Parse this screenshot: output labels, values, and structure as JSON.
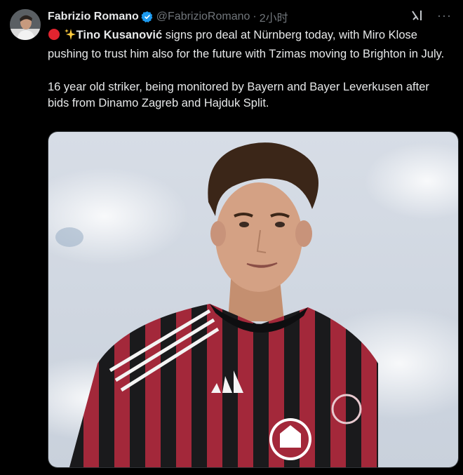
{
  "author": {
    "name": "Fabrizio Romano",
    "handle": "@FabrizioRomano",
    "separator": "·",
    "time": "2小时"
  },
  "tweet": {
    "headline_name": "Tino Kusanović",
    "paragraph1_rest": " signs pro deal at Nürnberg today, with Miro Klose pushing to trust him also for the future with Tzimas moving to Brighton in July.",
    "paragraph2": "16 year old striker, being monitored by Bayern and Bayer Leverkusen after bids from Dinamo Zagreb and Hajduk Split."
  },
  "icons": {
    "verified": "verified-badge-icon",
    "grok": "grok-icon",
    "more": "more-icon",
    "emoji1": "red-circle-emoji",
    "emoji2": "sparkles-emoji"
  },
  "colors": {
    "background": "#000000",
    "text": "#e7e9ea",
    "muted": "#71767b",
    "verified": "#1d9bf0",
    "jersey_red": "#a3283a",
    "jersey_black": "#1a1a1c"
  }
}
